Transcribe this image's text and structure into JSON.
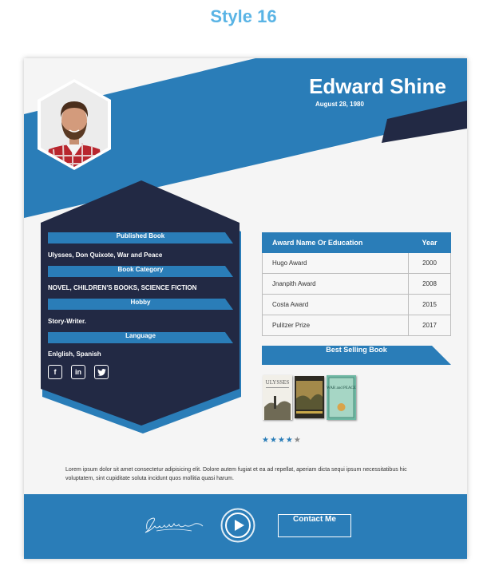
{
  "page_title": "Style 16",
  "profile": {
    "name": "Edward Shine",
    "dob": "August 28, 1980"
  },
  "sections": [
    {
      "label": "Published Book",
      "value": "Ulysses, Don Quixote, War and Peace"
    },
    {
      "label": "Book Category",
      "value": "NOVEL, CHILDREN'S BOOKS, SCIENCE FICTION"
    },
    {
      "label": "Hobby",
      "value": "Story-Writer."
    },
    {
      "label": "Language",
      "value": "Enlglish, Spanish"
    }
  ],
  "social": [
    {
      "icon": "facebook-icon",
      "glyph": "f"
    },
    {
      "icon": "linkedin-icon",
      "glyph": "in"
    },
    {
      "icon": "twitter-icon",
      "glyph": "t"
    }
  ],
  "awards": {
    "headers": [
      "Award Name Or Education",
      "Year"
    ],
    "rows": [
      [
        "Hugo Award",
        "2000"
      ],
      [
        "Jnanpith Award",
        "2008"
      ],
      [
        "Costa Award",
        "2015"
      ],
      [
        "Pulitzer Prize",
        "2017"
      ]
    ]
  },
  "best_selling": {
    "label": "Best Selling Book",
    "books": [
      "ULYSSES",
      "",
      "WAR and PEACE"
    ]
  },
  "rating": {
    "value": 4,
    "max": 5
  },
  "description": "Lorem ipsum dolor sit amet consectetur adipisicing elit. Dolore autem fugiat et ea ad repellat, aperiam dicta sequi ipsum necessitatibus hic voluptatem, sint cupiditate soluta incidunt quos mollitia quasi harum.",
  "footer": {
    "contact_label": "Contact Me",
    "signature": "Frank Sinatra"
  },
  "colors": {
    "accent_blue": "#2a7db8",
    "navy": "#222944",
    "title_blue": "#5ab4e5"
  }
}
